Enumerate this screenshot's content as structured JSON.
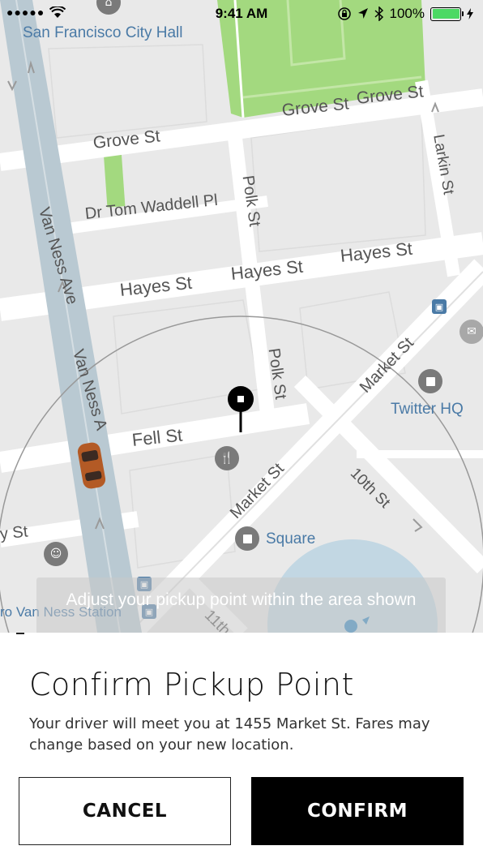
{
  "status_bar": {
    "signal": "●●●●●",
    "wifi_icon": "wifi-icon",
    "time": "9:41 AM",
    "battery_pct": "100%",
    "battery_level": 1.0
  },
  "map": {
    "streets": [
      "Grove St",
      "Grove St",
      "Grove St",
      "Dr Tom Waddell Pl",
      "Hayes St",
      "Hayes St",
      "Hayes St",
      "Fell St",
      "Van Ness Ave",
      "Van Ness A",
      "Polk St",
      "Polk St",
      "Larkin St",
      "Market St",
      "Market St",
      "10th St",
      "11th",
      "y St"
    ],
    "places": [
      "San Francisco City Hall",
      "Twitter HQ",
      "Square",
      "ro Van Ness Station"
    ],
    "colors": {
      "park": "#a3d97f",
      "road": "#ffffff",
      "ground": "#e9e9e9",
      "highway": "#b9c9d2",
      "accuracy": "#a8cbe0"
    }
  },
  "toast": {
    "text": "Adjust your pickup point within the area shown"
  },
  "sheet": {
    "title": "Confirm Pickup Point",
    "description": "Your driver will meet you at 1455 Market St. Fares may change based on your new location.",
    "cancel_label": "CANCEL",
    "confirm_label": "CONFIRM"
  }
}
